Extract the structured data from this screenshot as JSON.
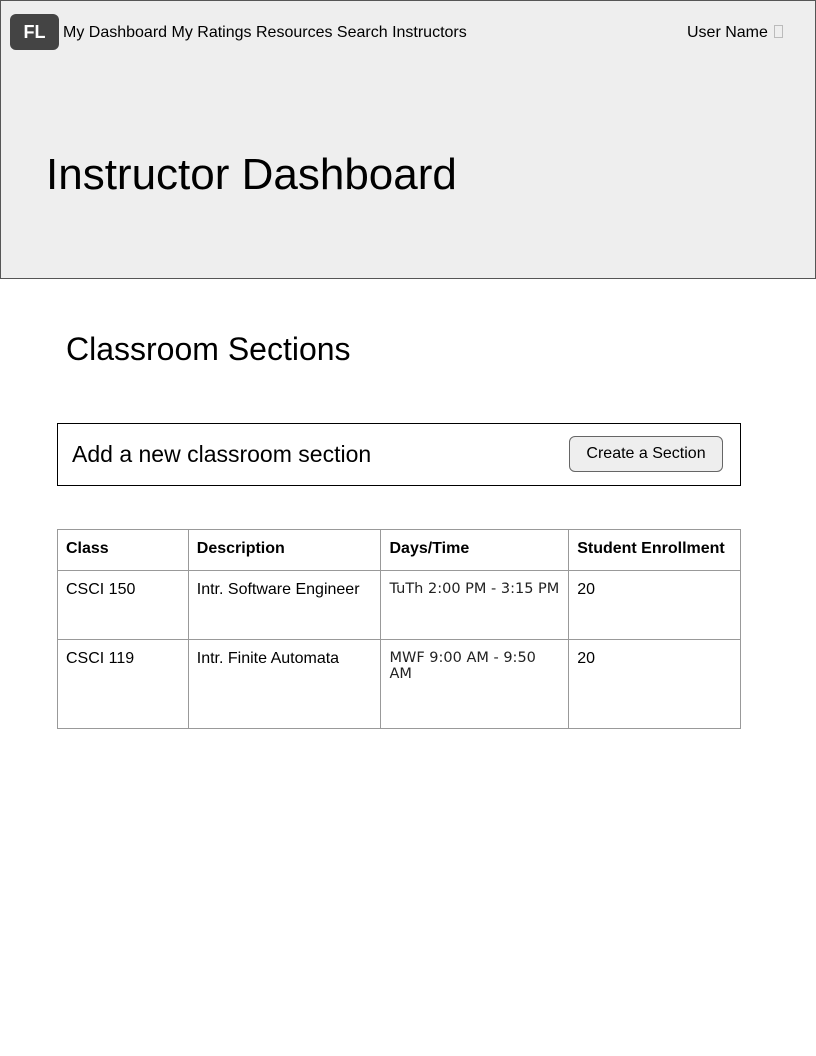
{
  "nav": {
    "logo": "FL",
    "links": [
      "My Dashboard",
      "My Ratings",
      "Resources",
      "Search Instructors"
    ],
    "user_name": "User Name"
  },
  "hero": {
    "title": "Instructor Dashboard"
  },
  "sections": {
    "title": "Classroom Sections",
    "add_prompt": "Add a new classroom section",
    "create_button": "Create a Section"
  },
  "table": {
    "headers": [
      "Class",
      "Description",
      "Days/Time",
      "Student Enrollment"
    ],
    "rows": [
      [
        "CSCI 150",
        "Intr. Software Engineer",
        "TuTh 2:00 PM - 3:15 PM",
        "20"
      ],
      [
        "CSCI 119",
        "Intr. Finite Automata",
        "MWF 9:00 AM - 9:50 AM",
        "20"
      ]
    ]
  }
}
